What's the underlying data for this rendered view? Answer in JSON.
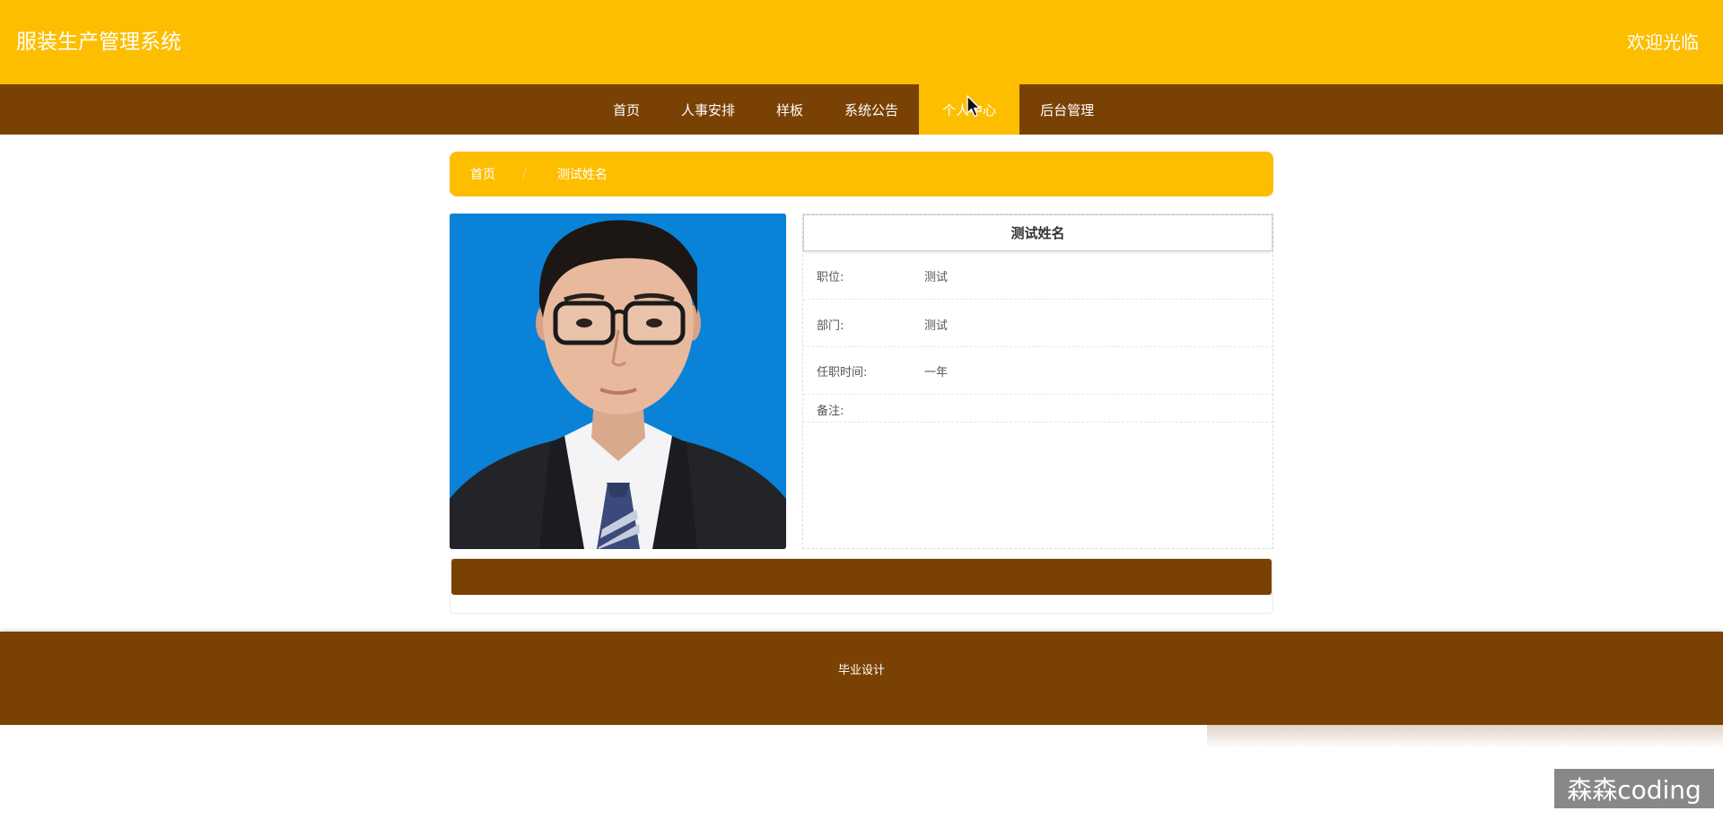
{
  "header": {
    "site_title": "服装生产管理系统",
    "welcome": "欢迎光临"
  },
  "nav": {
    "items": [
      {
        "label": "首页",
        "active": false
      },
      {
        "label": "人事安排",
        "active": false
      },
      {
        "label": "样板",
        "active": false
      },
      {
        "label": "系统公告",
        "active": false
      },
      {
        "label": "个人中心",
        "active": true
      },
      {
        "label": "后台管理",
        "active": false
      }
    ]
  },
  "breadcrumb": {
    "home": "首页",
    "separator": "/",
    "current": "测试姓名"
  },
  "profile": {
    "name": "测试姓名",
    "photo_alt": "员工证件照",
    "fields": [
      {
        "label": "职位:",
        "value": "测试"
      },
      {
        "label": "部门:",
        "value": "测试"
      },
      {
        "label": "任职时间:",
        "value": "一年"
      },
      {
        "label": "备注:",
        "value": ""
      }
    ]
  },
  "footer": {
    "text": "毕业设计"
  },
  "watermark": "森森coding",
  "colors": {
    "primary_yellow": "#FDBE00",
    "brown": "#7A4104",
    "white": "#FFFFFF"
  }
}
